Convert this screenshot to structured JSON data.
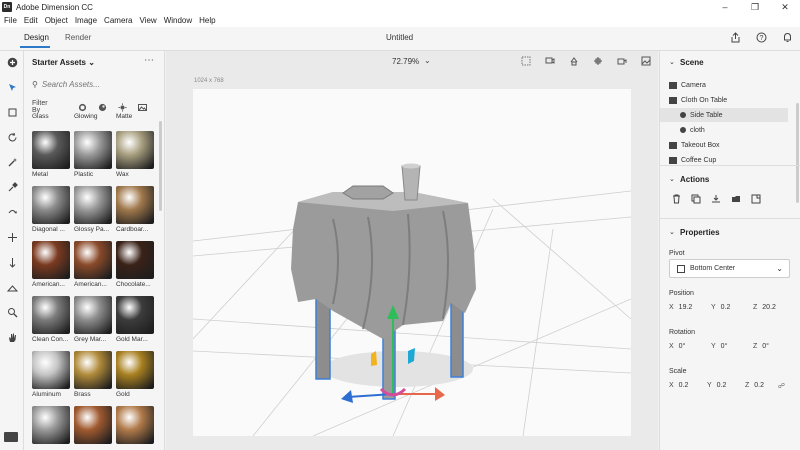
{
  "titlebar": {
    "title": "Adobe Dimension CC",
    "logo": "Dn"
  },
  "menu": [
    "File",
    "Edit",
    "Object",
    "Image",
    "Camera",
    "View",
    "Window",
    "Help"
  ],
  "modes": {
    "design": "Design",
    "render": "Render"
  },
  "document": {
    "title": "Untitled"
  },
  "assets": {
    "heading": "Starter Assets",
    "search_placeholder": "Search Assets...",
    "filter_label": "Filter By",
    "tiles": [
      {
        "label": "Glass",
        "color": "#b9b9b9"
      },
      {
        "label": "Glowing",
        "color": "#7a7a7a"
      },
      {
        "label": "Matte",
        "color": "#6a6a6a"
      },
      {
        "label": "Metal",
        "color": "#5a5a5a"
      },
      {
        "label": "Plastic",
        "color": "#9a9a9a"
      },
      {
        "label": "Wax",
        "color": "#a89f80"
      },
      {
        "label": "Diagonal ...",
        "color": "#8c8c8c"
      },
      {
        "label": "Glossy Pa...",
        "color": "#9a9a9a"
      },
      {
        "label": "Cardboar...",
        "color": "#a0784c"
      },
      {
        "label": "American...",
        "color": "#7a3a20"
      },
      {
        "label": "American...",
        "color": "#8a4a2a"
      },
      {
        "label": "Chocolate...",
        "color": "#3a2218"
      },
      {
        "label": "Clean Con...",
        "color": "#7c7c7c"
      },
      {
        "label": "Grey Mar...",
        "color": "#8e8e8e"
      },
      {
        "label": "Gold Mar...",
        "color": "#3c3c3c"
      },
      {
        "label": "Aluminum",
        "color": "#c4c4c4"
      },
      {
        "label": "Brass",
        "color": "#b08a3a"
      },
      {
        "label": "Gold",
        "color": "#a88020"
      },
      {
        "label": "",
        "color": "#9a9a9a"
      },
      {
        "label": "",
        "color": "#a05a30"
      },
      {
        "label": "",
        "color": "#b07a4a"
      }
    ]
  },
  "viewport": {
    "zoom": "72.79%",
    "canvas_size": "1024 x 768"
  },
  "scene": {
    "heading": "Scene",
    "items": [
      {
        "label": "Camera",
        "indent": 0,
        "selected": false
      },
      {
        "label": "Cloth On Table",
        "indent": 0,
        "selected": false
      },
      {
        "label": "Side Table",
        "indent": 1,
        "selected": true
      },
      {
        "label": "cloth",
        "indent": 1,
        "selected": false
      },
      {
        "label": "Takeout Box",
        "indent": 0,
        "selected": false
      },
      {
        "label": "Coffee Cup",
        "indent": 0,
        "selected": false
      }
    ]
  },
  "actions": {
    "heading": "Actions"
  },
  "properties": {
    "heading": "Properties",
    "pivot_label": "Pivot",
    "pivot_value": "Bottom Center",
    "position": {
      "label": "Position",
      "x": "19.2",
      "y": "0.2",
      "z": "20.2"
    },
    "rotation": {
      "label": "Rotation",
      "x": "0°",
      "y": "0°",
      "z": "0°"
    },
    "scale": {
      "label": "Scale",
      "x": "0.2",
      "y": "0.2",
      "z": "0.2"
    }
  },
  "axes": {
    "x": "X",
    "y": "Y",
    "z": "Z"
  },
  "colors": {
    "accent": "#2d78c8",
    "gizmo_green": "#2ebd59",
    "gizmo_red": "#e8664a",
    "gizmo_blue": "#2d6fd1",
    "gizmo_yellow": "#f2b31b",
    "gizmo_pink": "#d44c9a"
  }
}
